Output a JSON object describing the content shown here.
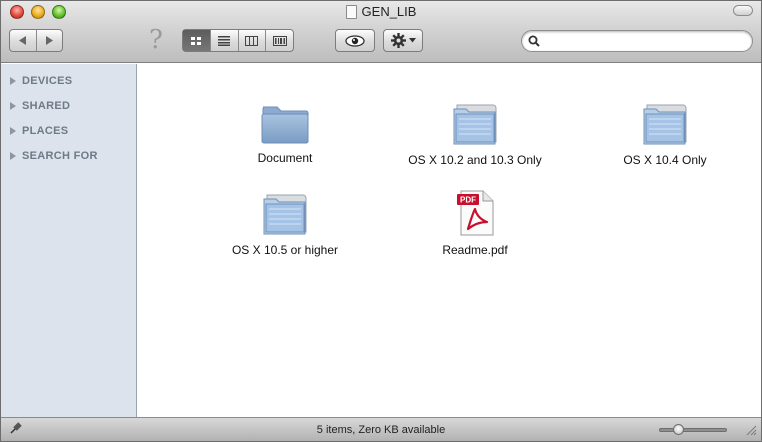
{
  "window": {
    "title": "GEN_LIB"
  },
  "toolbar": {
    "help_glyph": "?",
    "search": {
      "value": "",
      "placeholder": ""
    }
  },
  "sidebar": {
    "sections": [
      {
        "label": "DEVICES"
      },
      {
        "label": "SHARED"
      },
      {
        "label": "PLACES"
      },
      {
        "label": "SEARCH FOR"
      }
    ]
  },
  "content": {
    "items": [
      {
        "label": "Document",
        "icon": "plain-folder-icon"
      },
      {
        "label": "OS X 10.2 and 10.3 Only",
        "icon": "folder-icon"
      },
      {
        "label": "OS X 10.4 Only",
        "icon": "folder-icon"
      },
      {
        "label": "OS X 10.5 or higher",
        "icon": "folder-icon"
      },
      {
        "label": "Readme.pdf",
        "icon": "pdf-file-icon"
      }
    ]
  },
  "statusbar": {
    "text": "5 items, Zero KB available",
    "icon_size_level": 0.2
  },
  "colors": {
    "sidebar_bg": "#dce3ec",
    "sidebar_text": "#6e7a86",
    "folder_blue": "#8fb0d8",
    "pdf_red": "#c8102e"
  }
}
